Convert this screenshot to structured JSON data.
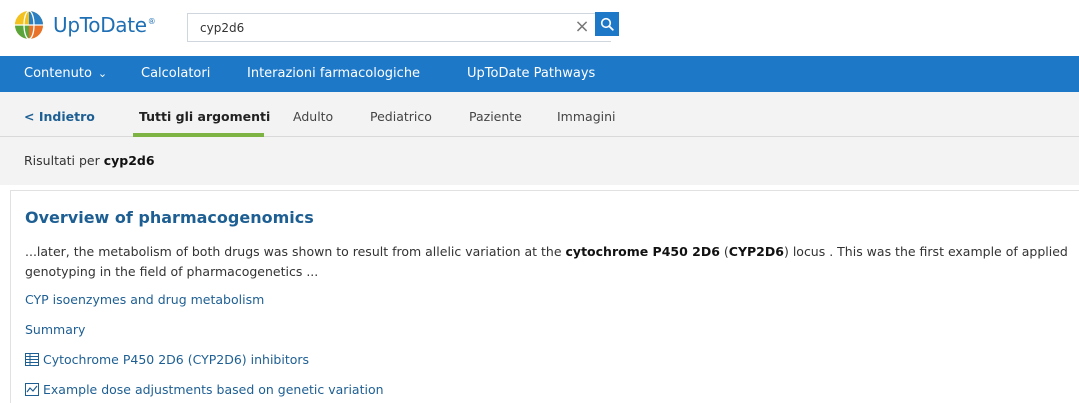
{
  "header": {
    "logo_text": "UpToDate",
    "logo_reg": "®",
    "search": {
      "value": "cyp2d6",
      "placeholder": "",
      "clear_icon": "close-icon",
      "search_icon": "search-icon"
    }
  },
  "nav": {
    "items": [
      {
        "label": "Contenuto",
        "has_dropdown": true
      },
      {
        "label": "Calcolatori"
      },
      {
        "label": "Interazioni farmacologiche"
      },
      {
        "label": "UpToDate Pathways"
      }
    ]
  },
  "tabs": {
    "back_label": "Indietro",
    "items": [
      {
        "label": "Tutti gli argomenti",
        "active": true
      },
      {
        "label": "Adulto"
      },
      {
        "label": "Pediatrico"
      },
      {
        "label": "Paziente"
      },
      {
        "label": "Immagini"
      }
    ]
  },
  "results": {
    "prefix": "Risultati per ",
    "query": "cyp2d6"
  },
  "result": {
    "title": "Overview of pharmacogenomics",
    "snippet_line1_a": "...later, the metabolism of both drugs was shown to result from allelic variation at the ",
    "snippet_line1_b": "cytochrome P450 2D6",
    "snippet_line1_c": " (",
    "snippet_line1_d": "CYP2D6",
    "snippet_line1_e": ") locus . This was the first example of applied",
    "snippet_line2": "genotyping in the field of pharmacogenetics ...",
    "links": [
      {
        "label": "CYP isoenzymes and drug metabolism",
        "icon": ""
      },
      {
        "label": "Summary",
        "icon": ""
      },
      {
        "label": "Cytochrome P450 2D6 (CYP2D6) inhibitors",
        "icon": "table-icon"
      },
      {
        "label": "Example dose adjustments based on genetic variation",
        "icon": "graph-icon"
      }
    ]
  },
  "colors": {
    "brand_blue": "#1e78c8",
    "link_blue": "#1e5f93",
    "active_tab_green": "#7cb342"
  }
}
